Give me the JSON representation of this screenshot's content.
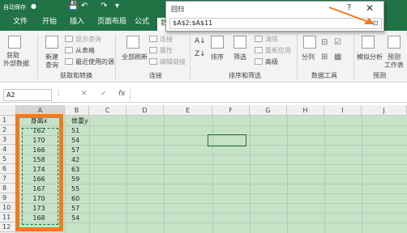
{
  "titlebar": {
    "autosave": "自动保存",
    "autosave_state": "●",
    "save_icon": "💾",
    "undo_icon": "↶",
    "redo_icon": "↷",
    "dropdown_icon": "▾"
  },
  "tabs": [
    "文件",
    "开始",
    "插入",
    "页面布局",
    "公式",
    "数"
  ],
  "ribbon": {
    "get_external_data": "获取",
    "get_external_data2": "外部数据",
    "new_query": "新建",
    "new_query2": "查询",
    "show_queries": "显示查询",
    "from_table": "从表格",
    "recent_sources": "最近使用的源",
    "refresh_all": "全部刷新",
    "connections": "连接",
    "properties": "属性",
    "edit_links": "编辑链接",
    "sort": "排序",
    "filter": "筛选",
    "clear": "清除",
    "reapply": "重新应用",
    "advanced": "高级",
    "text_to_columns": "分列",
    "what_if": "模拟分析",
    "forecast": "预测",
    "forecast_sheet": "工作表",
    "groups": {
      "get_transform": "获取和转换",
      "connections": "连接",
      "sort_filter": "排序和筛选",
      "data_tools": "数据工具",
      "forecast": "预测"
    }
  },
  "formula_bar": {
    "name_box": "A2",
    "cancel_icon": "✕",
    "enter_icon": "✓",
    "fx_label": "fx",
    "value": ""
  },
  "columns": [
    "A",
    "B",
    "C",
    "D",
    "E",
    "F",
    "G",
    "H",
    "I",
    "J"
  ],
  "rows": [
    "1",
    "2",
    "3",
    "4",
    "5",
    "6",
    "7",
    "8",
    "9",
    "10",
    "11",
    "12"
  ],
  "table": {
    "header_a": "身高x",
    "header_b": "体重y",
    "col_a": [
      "162",
      "170",
      "166",
      "158",
      "174",
      "166",
      "167",
      "170",
      "173",
      "168"
    ],
    "col_b": [
      "51",
      "54",
      "57",
      "42",
      "63",
      "59",
      "55",
      "60",
      "57",
      "54"
    ]
  },
  "dialog": {
    "title": "回归",
    "help": "?",
    "close": "✕",
    "input_value": "$A$2:$A$11",
    "collapse_icon": "⊡"
  },
  "colors": {
    "excel_green": "#217346",
    "selection_fill": "#c6e3c8",
    "highlight_orange": "#f07a1f"
  }
}
